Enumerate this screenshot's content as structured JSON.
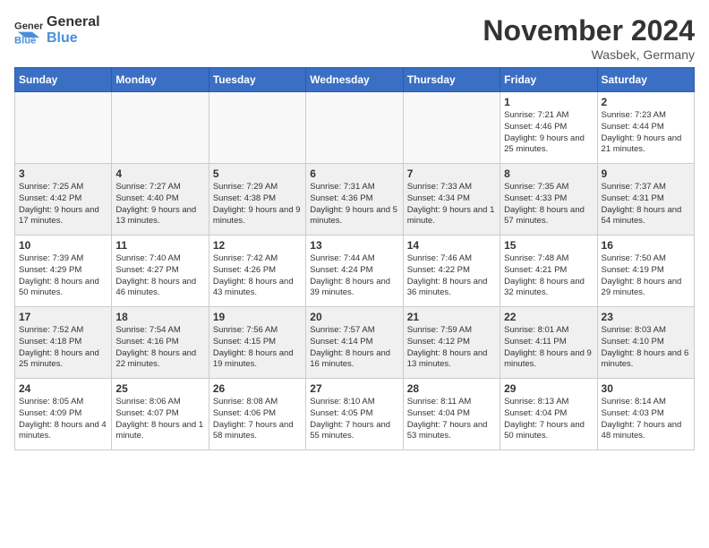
{
  "logo": {
    "general": "General",
    "blue": "Blue"
  },
  "header": {
    "month": "November 2024",
    "location": "Wasbek, Germany"
  },
  "weekdays": [
    "Sunday",
    "Monday",
    "Tuesday",
    "Wednesday",
    "Thursday",
    "Friday",
    "Saturday"
  ],
  "weeks": [
    [
      {
        "day": "",
        "info": ""
      },
      {
        "day": "",
        "info": ""
      },
      {
        "day": "",
        "info": ""
      },
      {
        "day": "",
        "info": ""
      },
      {
        "day": "",
        "info": ""
      },
      {
        "day": "1",
        "info": "Sunrise: 7:21 AM\nSunset: 4:46 PM\nDaylight: 9 hours and 25 minutes."
      },
      {
        "day": "2",
        "info": "Sunrise: 7:23 AM\nSunset: 4:44 PM\nDaylight: 9 hours and 21 minutes."
      }
    ],
    [
      {
        "day": "3",
        "info": "Sunrise: 7:25 AM\nSunset: 4:42 PM\nDaylight: 9 hours and 17 minutes."
      },
      {
        "day": "4",
        "info": "Sunrise: 7:27 AM\nSunset: 4:40 PM\nDaylight: 9 hours and 13 minutes."
      },
      {
        "day": "5",
        "info": "Sunrise: 7:29 AM\nSunset: 4:38 PM\nDaylight: 9 hours and 9 minutes."
      },
      {
        "day": "6",
        "info": "Sunrise: 7:31 AM\nSunset: 4:36 PM\nDaylight: 9 hours and 5 minutes."
      },
      {
        "day": "7",
        "info": "Sunrise: 7:33 AM\nSunset: 4:34 PM\nDaylight: 9 hours and 1 minute."
      },
      {
        "day": "8",
        "info": "Sunrise: 7:35 AM\nSunset: 4:33 PM\nDaylight: 8 hours and 57 minutes."
      },
      {
        "day": "9",
        "info": "Sunrise: 7:37 AM\nSunset: 4:31 PM\nDaylight: 8 hours and 54 minutes."
      }
    ],
    [
      {
        "day": "10",
        "info": "Sunrise: 7:39 AM\nSunset: 4:29 PM\nDaylight: 8 hours and 50 minutes."
      },
      {
        "day": "11",
        "info": "Sunrise: 7:40 AM\nSunset: 4:27 PM\nDaylight: 8 hours and 46 minutes."
      },
      {
        "day": "12",
        "info": "Sunrise: 7:42 AM\nSunset: 4:26 PM\nDaylight: 8 hours and 43 minutes."
      },
      {
        "day": "13",
        "info": "Sunrise: 7:44 AM\nSunset: 4:24 PM\nDaylight: 8 hours and 39 minutes."
      },
      {
        "day": "14",
        "info": "Sunrise: 7:46 AM\nSunset: 4:22 PM\nDaylight: 8 hours and 36 minutes."
      },
      {
        "day": "15",
        "info": "Sunrise: 7:48 AM\nSunset: 4:21 PM\nDaylight: 8 hours and 32 minutes."
      },
      {
        "day": "16",
        "info": "Sunrise: 7:50 AM\nSunset: 4:19 PM\nDaylight: 8 hours and 29 minutes."
      }
    ],
    [
      {
        "day": "17",
        "info": "Sunrise: 7:52 AM\nSunset: 4:18 PM\nDaylight: 8 hours and 25 minutes."
      },
      {
        "day": "18",
        "info": "Sunrise: 7:54 AM\nSunset: 4:16 PM\nDaylight: 8 hours and 22 minutes."
      },
      {
        "day": "19",
        "info": "Sunrise: 7:56 AM\nSunset: 4:15 PM\nDaylight: 8 hours and 19 minutes."
      },
      {
        "day": "20",
        "info": "Sunrise: 7:57 AM\nSunset: 4:14 PM\nDaylight: 8 hours and 16 minutes."
      },
      {
        "day": "21",
        "info": "Sunrise: 7:59 AM\nSunset: 4:12 PM\nDaylight: 8 hours and 13 minutes."
      },
      {
        "day": "22",
        "info": "Sunrise: 8:01 AM\nSunset: 4:11 PM\nDaylight: 8 hours and 9 minutes."
      },
      {
        "day": "23",
        "info": "Sunrise: 8:03 AM\nSunset: 4:10 PM\nDaylight: 8 hours and 6 minutes."
      }
    ],
    [
      {
        "day": "24",
        "info": "Sunrise: 8:05 AM\nSunset: 4:09 PM\nDaylight: 8 hours and 4 minutes."
      },
      {
        "day": "25",
        "info": "Sunrise: 8:06 AM\nSunset: 4:07 PM\nDaylight: 8 hours and 1 minute."
      },
      {
        "day": "26",
        "info": "Sunrise: 8:08 AM\nSunset: 4:06 PM\nDaylight: 7 hours and 58 minutes."
      },
      {
        "day": "27",
        "info": "Sunrise: 8:10 AM\nSunset: 4:05 PM\nDaylight: 7 hours and 55 minutes."
      },
      {
        "day": "28",
        "info": "Sunrise: 8:11 AM\nSunset: 4:04 PM\nDaylight: 7 hours and 53 minutes."
      },
      {
        "day": "29",
        "info": "Sunrise: 8:13 AM\nSunset: 4:04 PM\nDaylight: 7 hours and 50 minutes."
      },
      {
        "day": "30",
        "info": "Sunrise: 8:14 AM\nSunset: 4:03 PM\nDaylight: 7 hours and 48 minutes."
      }
    ]
  ]
}
